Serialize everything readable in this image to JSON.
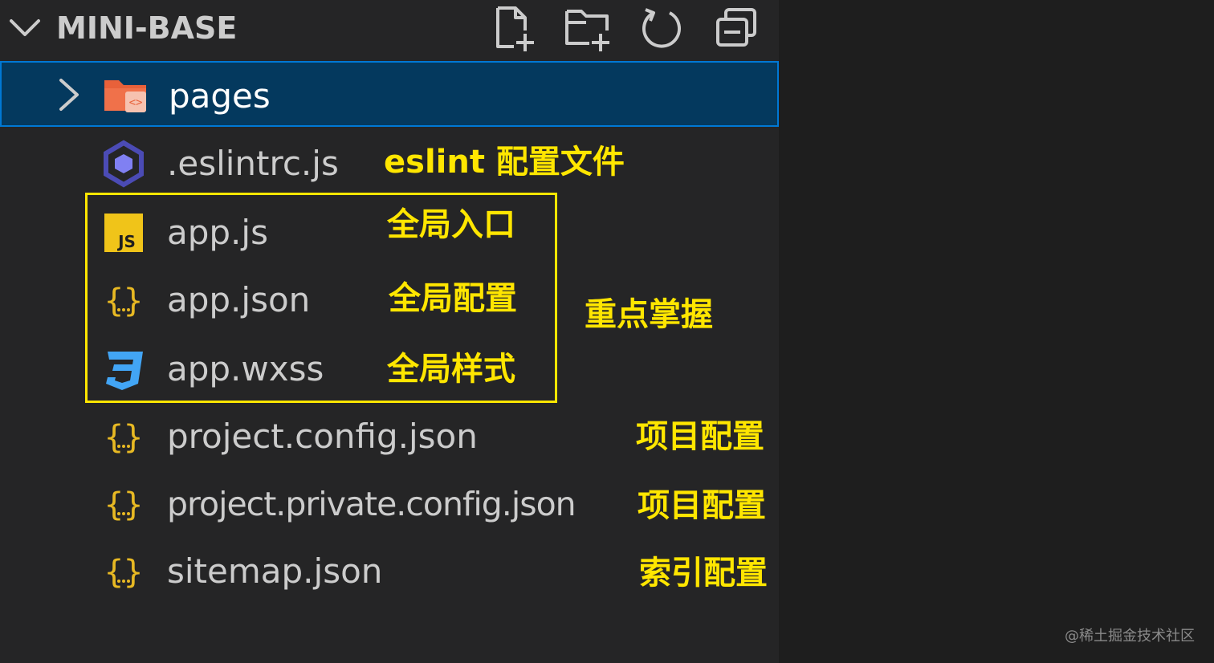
{
  "header": {
    "title": "MINI-BASE",
    "actions": [
      {
        "name": "new-file",
        "icon": "new-file-icon"
      },
      {
        "name": "new-folder",
        "icon": "new-folder-icon"
      },
      {
        "name": "refresh",
        "icon": "refresh-icon"
      },
      {
        "name": "collapse-all",
        "icon": "collapse-all-icon"
      }
    ]
  },
  "tree": {
    "folder": {
      "label": "pages",
      "icon": "folder-icon",
      "expanded": false
    },
    "files": [
      {
        "label": ".eslintrc.js",
        "icon": "eslint-icon"
      },
      {
        "label": "app.js",
        "icon": "javascript-icon"
      },
      {
        "label": "app.json",
        "icon": "json-icon"
      },
      {
        "label": "app.wxss",
        "icon": "css-icon"
      },
      {
        "label": "project.config.json",
        "icon": "json-icon"
      },
      {
        "label": "project.private.config.json",
        "icon": "json-icon"
      },
      {
        "label": "sitemap.json",
        "icon": "json-icon"
      }
    ]
  },
  "annotations": {
    "eslintrc": "eslint 配置文件",
    "app_js": "全局入口",
    "app_json": "全局配置",
    "app_wxss": "全局样式",
    "group": "重点掌握",
    "project_config": "项目配置",
    "project_private_config": "项目配置",
    "sitemap": "索引配置"
  },
  "watermark": "@稀土掘金技术社区",
  "colors": {
    "sidebar_bg": "#252526",
    "selection_bg": "#04395e",
    "selection_border": "#0078d4",
    "annotation": "#ffe600",
    "text": "#cccccc",
    "folder": "#e8613a",
    "javascript": "#f0c419",
    "json": "#e8b923",
    "css": "#42a5f5",
    "eslint": "#4b4bb5"
  }
}
